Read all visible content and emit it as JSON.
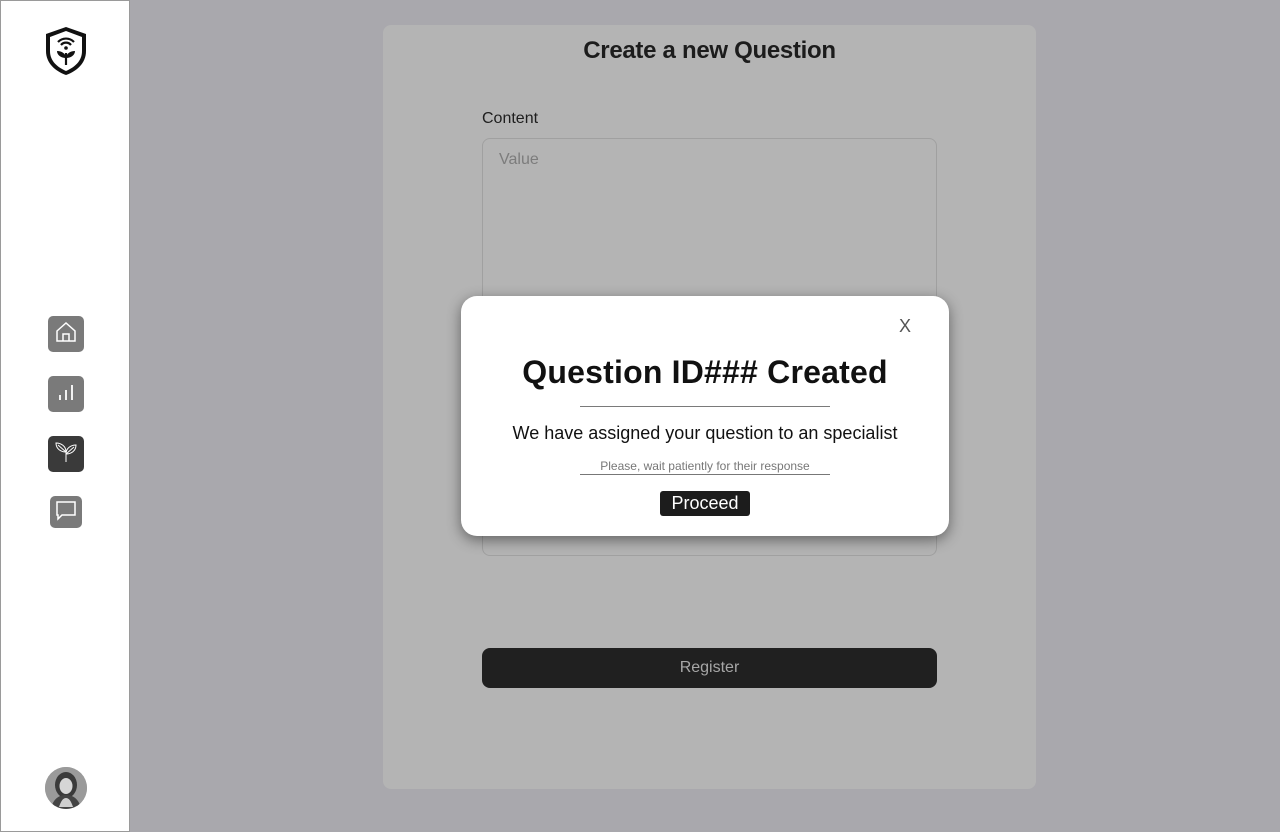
{
  "sidebar": {
    "logo_icon": "shield-plant-wifi-icon",
    "items": [
      {
        "icon": "home-icon"
      },
      {
        "icon": "bar-chart-icon"
      },
      {
        "icon": "plant-icon"
      },
      {
        "icon": "chat-icon"
      }
    ],
    "avatar": "user-avatar"
  },
  "form": {
    "title": "Create a new Question",
    "content_label": "Content",
    "content_placeholder": "Value",
    "register_label": "Register"
  },
  "modal": {
    "close_label": "X",
    "title": "Question ID### Created",
    "message": "We have assigned your question to an specialist",
    "subtext": "Please, wait patiently for their response",
    "proceed_label": "Proceed"
  },
  "colors": {
    "overlay": "#a9a8ad",
    "card": "#b4b4b4",
    "button_dark": "#202020",
    "nav_active": "#3a3a3a",
    "nav_inactive": "#7a7a7a"
  }
}
